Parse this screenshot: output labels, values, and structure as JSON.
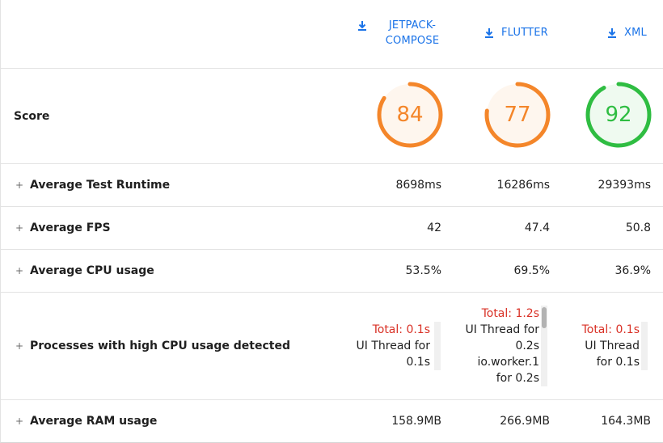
{
  "columns": [
    {
      "name": "JETPACK-COMPOSE",
      "line1": "JETPACK-",
      "line2": "COMPOSE",
      "icon": "download-icon"
    },
    {
      "name": "FLUTTER",
      "icon": "download-icon"
    },
    {
      "name": "XML",
      "icon": "download-icon"
    }
  ],
  "rows": {
    "score": {
      "label": "Score",
      "values": [
        "84",
        "77",
        "92"
      ],
      "fractions": [
        0.84,
        0.77,
        0.92
      ],
      "colors": [
        "#f4862a",
        "#f4862a",
        "#2fbd42"
      ]
    },
    "runtime": {
      "label": "Average Test Runtime",
      "values": [
        "8698ms",
        "16286ms",
        "29393ms"
      ]
    },
    "fps": {
      "label": "Average FPS",
      "values": [
        "42",
        "47.4",
        "50.8"
      ]
    },
    "cpu": {
      "label": "Average CPU usage",
      "values": [
        "53.5%",
        "69.5%",
        "36.9%"
      ]
    },
    "processes": {
      "label": "Processes with high CPU usage detected",
      "cells": [
        {
          "total": "Total: 0.1s",
          "lines": [
            "UI Thread for",
            "0.1s"
          ]
        },
        {
          "total": "Total: 1.2s",
          "lines": [
            "UI Thread for",
            "0.2s",
            "io.worker.1",
            "for 0.2s"
          ]
        },
        {
          "total": "Total: 0.1s",
          "lines": [
            "UI Thread",
            "for 0.1s"
          ]
        }
      ]
    },
    "ram": {
      "label": "Average RAM usage",
      "values": [
        "158.9MB",
        "266.9MB",
        "164.3MB"
      ]
    }
  },
  "expand_symbol": "+",
  "colors": {
    "link": "#1a73e8",
    "warning": "#d93025",
    "orange": "#f4862a",
    "green": "#2fbd42"
  }
}
